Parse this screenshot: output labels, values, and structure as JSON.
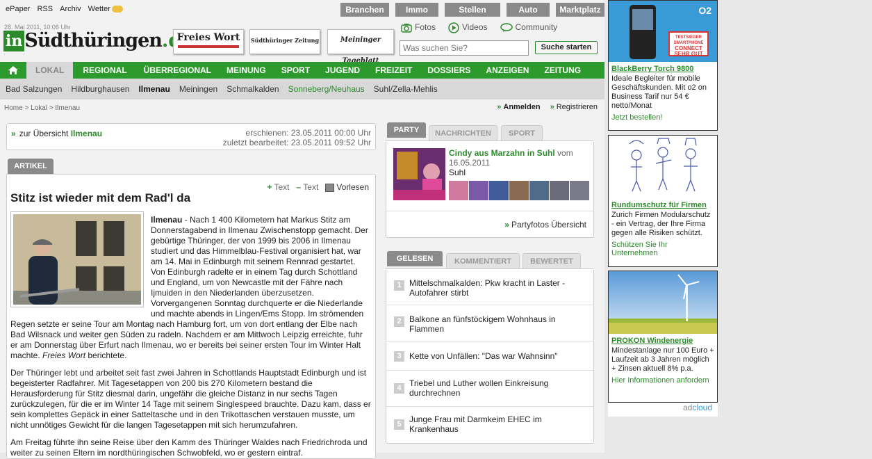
{
  "topbar": {
    "links": [
      "ePaper",
      "RSS",
      "Archiv",
      "Wetter"
    ],
    "rubriken": [
      "Branchen",
      "Immo",
      "Stellen",
      "Auto",
      "Marktplatz"
    ]
  },
  "header": {
    "date": "28. Mai 2011, 10:06 Uhr",
    "logo_in": "in",
    "logo_name": "Südthüringen",
    "logo_tld": ".de",
    "papers": [
      "Freies Wort",
      "Südthüringer Zeitung",
      "Meininger Tageblatt"
    ],
    "media": [
      "Fotos",
      "Videos",
      "Community"
    ],
    "search_placeholder": "Was suchen Sie?",
    "search_button": "Suche starten"
  },
  "mainnav": [
    "LOKAL",
    "REGIONAL",
    "ÜBERREGIONAL",
    "MEINUNG",
    "SPORT",
    "JUGEND",
    "FREIZEIT",
    "DOSSIERS",
    "ANZEIGEN",
    "ZEITUNG"
  ],
  "subnav": [
    "Bad Salzungen",
    "Hildburghausen",
    "Ilmenau",
    "Meiningen",
    "Schmalkalden",
    "Sonneberg/Neuhaus",
    "Suhl/Zella-Mehlis"
  ],
  "breadcrumb": [
    "Home",
    "Lokal",
    "Ilmenau"
  ],
  "auth": {
    "login": "Anmelden",
    "register": "Registrieren"
  },
  "article_meta": {
    "back_prefix": "zur Übersicht",
    "back_place": "Ilmenau",
    "published": "erschienen: 23.05.2011 00:00 Uhr",
    "edited": "zuletzt bearbeitet: 23.05.2011 09:52 Uhr"
  },
  "article": {
    "tab": "ARTIKEL",
    "text_plus": "Text",
    "text_minus": "Text",
    "read_aloud": "Vorlesen",
    "title": "Stitz ist wieder mit dem Rad'l da",
    "dateline": "Ilmenau",
    "p1": " - Nach 1 400 Kilometern hat Markus Stitz am Donnerstagabend in Ilmenau Zwischenstopp gemacht. Der gebürtige Thüringer, der von 1999 bis 2006 in Ilmenau studiert und das Himmelblau-Festival organisiert hat, war am 14. Mai in Edinburgh mit seinem Rennrad gestartet. Von Edinburgh radelte er in einem Tag durch Schottland und England, um von Newcastle mit der Fähre nach Ijmuiden in den Niederlanden überzusetzen. Vorvergangenen Sonntag durchquerte er die Niederlande und machte abends in Lingen/Ems Stopp. Im strömenden Regen setzte er seine Tour am Montag nach Hamburg fort, um von dort entlang der Elbe nach Bad Wilsnack und weiter gen Süden zu radeln. Nachdem er am Mittwoch Leipzig erreichte, fuhr er am Donnerstag über Erfurt nach Ilmenau, wo er bereits bei seiner ersten Tour im Winter Halt machte. ",
    "source": "Freies Wort",
    "p1_end": " berichtete.",
    "p2": "Der Thüringer lebt und arbeitet seit fast zwei Jahren in Schottlands Hauptstadt Edinburgh und ist begeisterter Radfahrer. Mit Tagesetappen von 200 bis 270 Kilometern bestand die Herausforderung für Stitz diesmal darin, ungefähr die gleiche Distanz in nur sechs Tagen zurückzulegen, für die er im Winter 14 Tage mit seinem Singlespeed brauchte. Dazu kam, dass er sein komplettes Gepäck in einer Satteltasche und in den Trikottaschen verstauen musste, um nicht unnötiges Gewicht für die langen Tagesetappen mit sich herumzufahren.",
    "p3": "Am Freitag führte ihn seine Reise über den Kamm des Thüringer Waldes nach Friedrichroda und weiter zu seinen Eltern im nordthüringischen Schwobfeld, wo er gestern eintraf."
  },
  "party": {
    "tabs": [
      "PARTY",
      "NACHRICHTEN",
      "SPORT"
    ],
    "title": "Cindy aus Marzahn in Suhl",
    "from": " vom",
    "date": "16.05.2011",
    "place": "Suhl",
    "overview": "Partyfotos Übersicht"
  },
  "toplist": {
    "tabs": [
      "GELESEN",
      "KOMMENTIERT",
      "BEWERTET"
    ],
    "items": [
      {
        "n": "1",
        "text": "Mittelschmalkalden: Pkw kracht in Laster - Autofahrer stirbt"
      },
      {
        "n": "2",
        "text": "Balkone an fünfstöckigem Wohnhaus in Flammen"
      },
      {
        "n": "3",
        "text": "Kette von Unfällen: \"Das war Wahnsinn\""
      },
      {
        "n": "4",
        "text": "Triebel und Luther wollen Einkreisung durchrechnen"
      },
      {
        "n": "5",
        "text": "Junge Frau mit Darmkeim EHEC im Krankenhaus"
      }
    ]
  },
  "ads": [
    {
      "title": "BlackBerry Torch 9800",
      "desc": "Ideale Begleiter für mobile Geschäftskunden. Mit o2 on Business Tarif nur 54 € netto/Monat",
      "cta": "Jetzt bestellen!",
      "brand": "O2",
      "badge_small": "TESTSIEGER SMARTPHONE",
      "badge": "CONNECT SEHR GUT"
    },
    {
      "title": "Rundumschutz für Firmen",
      "desc": "Zurich Firmen Modularschutz - ein Vertrag, der Ihre Firma gegen alle Risiken schützt.",
      "cta": "Schützen Sie Ihr Unternehmen"
    },
    {
      "title": "PROKON Windenergie",
      "desc": "Mindestanlage nur 100 Euro + Laufzeit ab 3 Jahren möglich + Zinsen aktuell 8% p.a.",
      "cta": "Hier Informationen anfordern"
    }
  ],
  "adcloud": {
    "pre": "ad",
    "post": "cloud"
  },
  "colors": {
    "brand_green": "#2c9a2c",
    "link_green": "#2c8a2c",
    "grey_button": "#8a8a8a"
  }
}
